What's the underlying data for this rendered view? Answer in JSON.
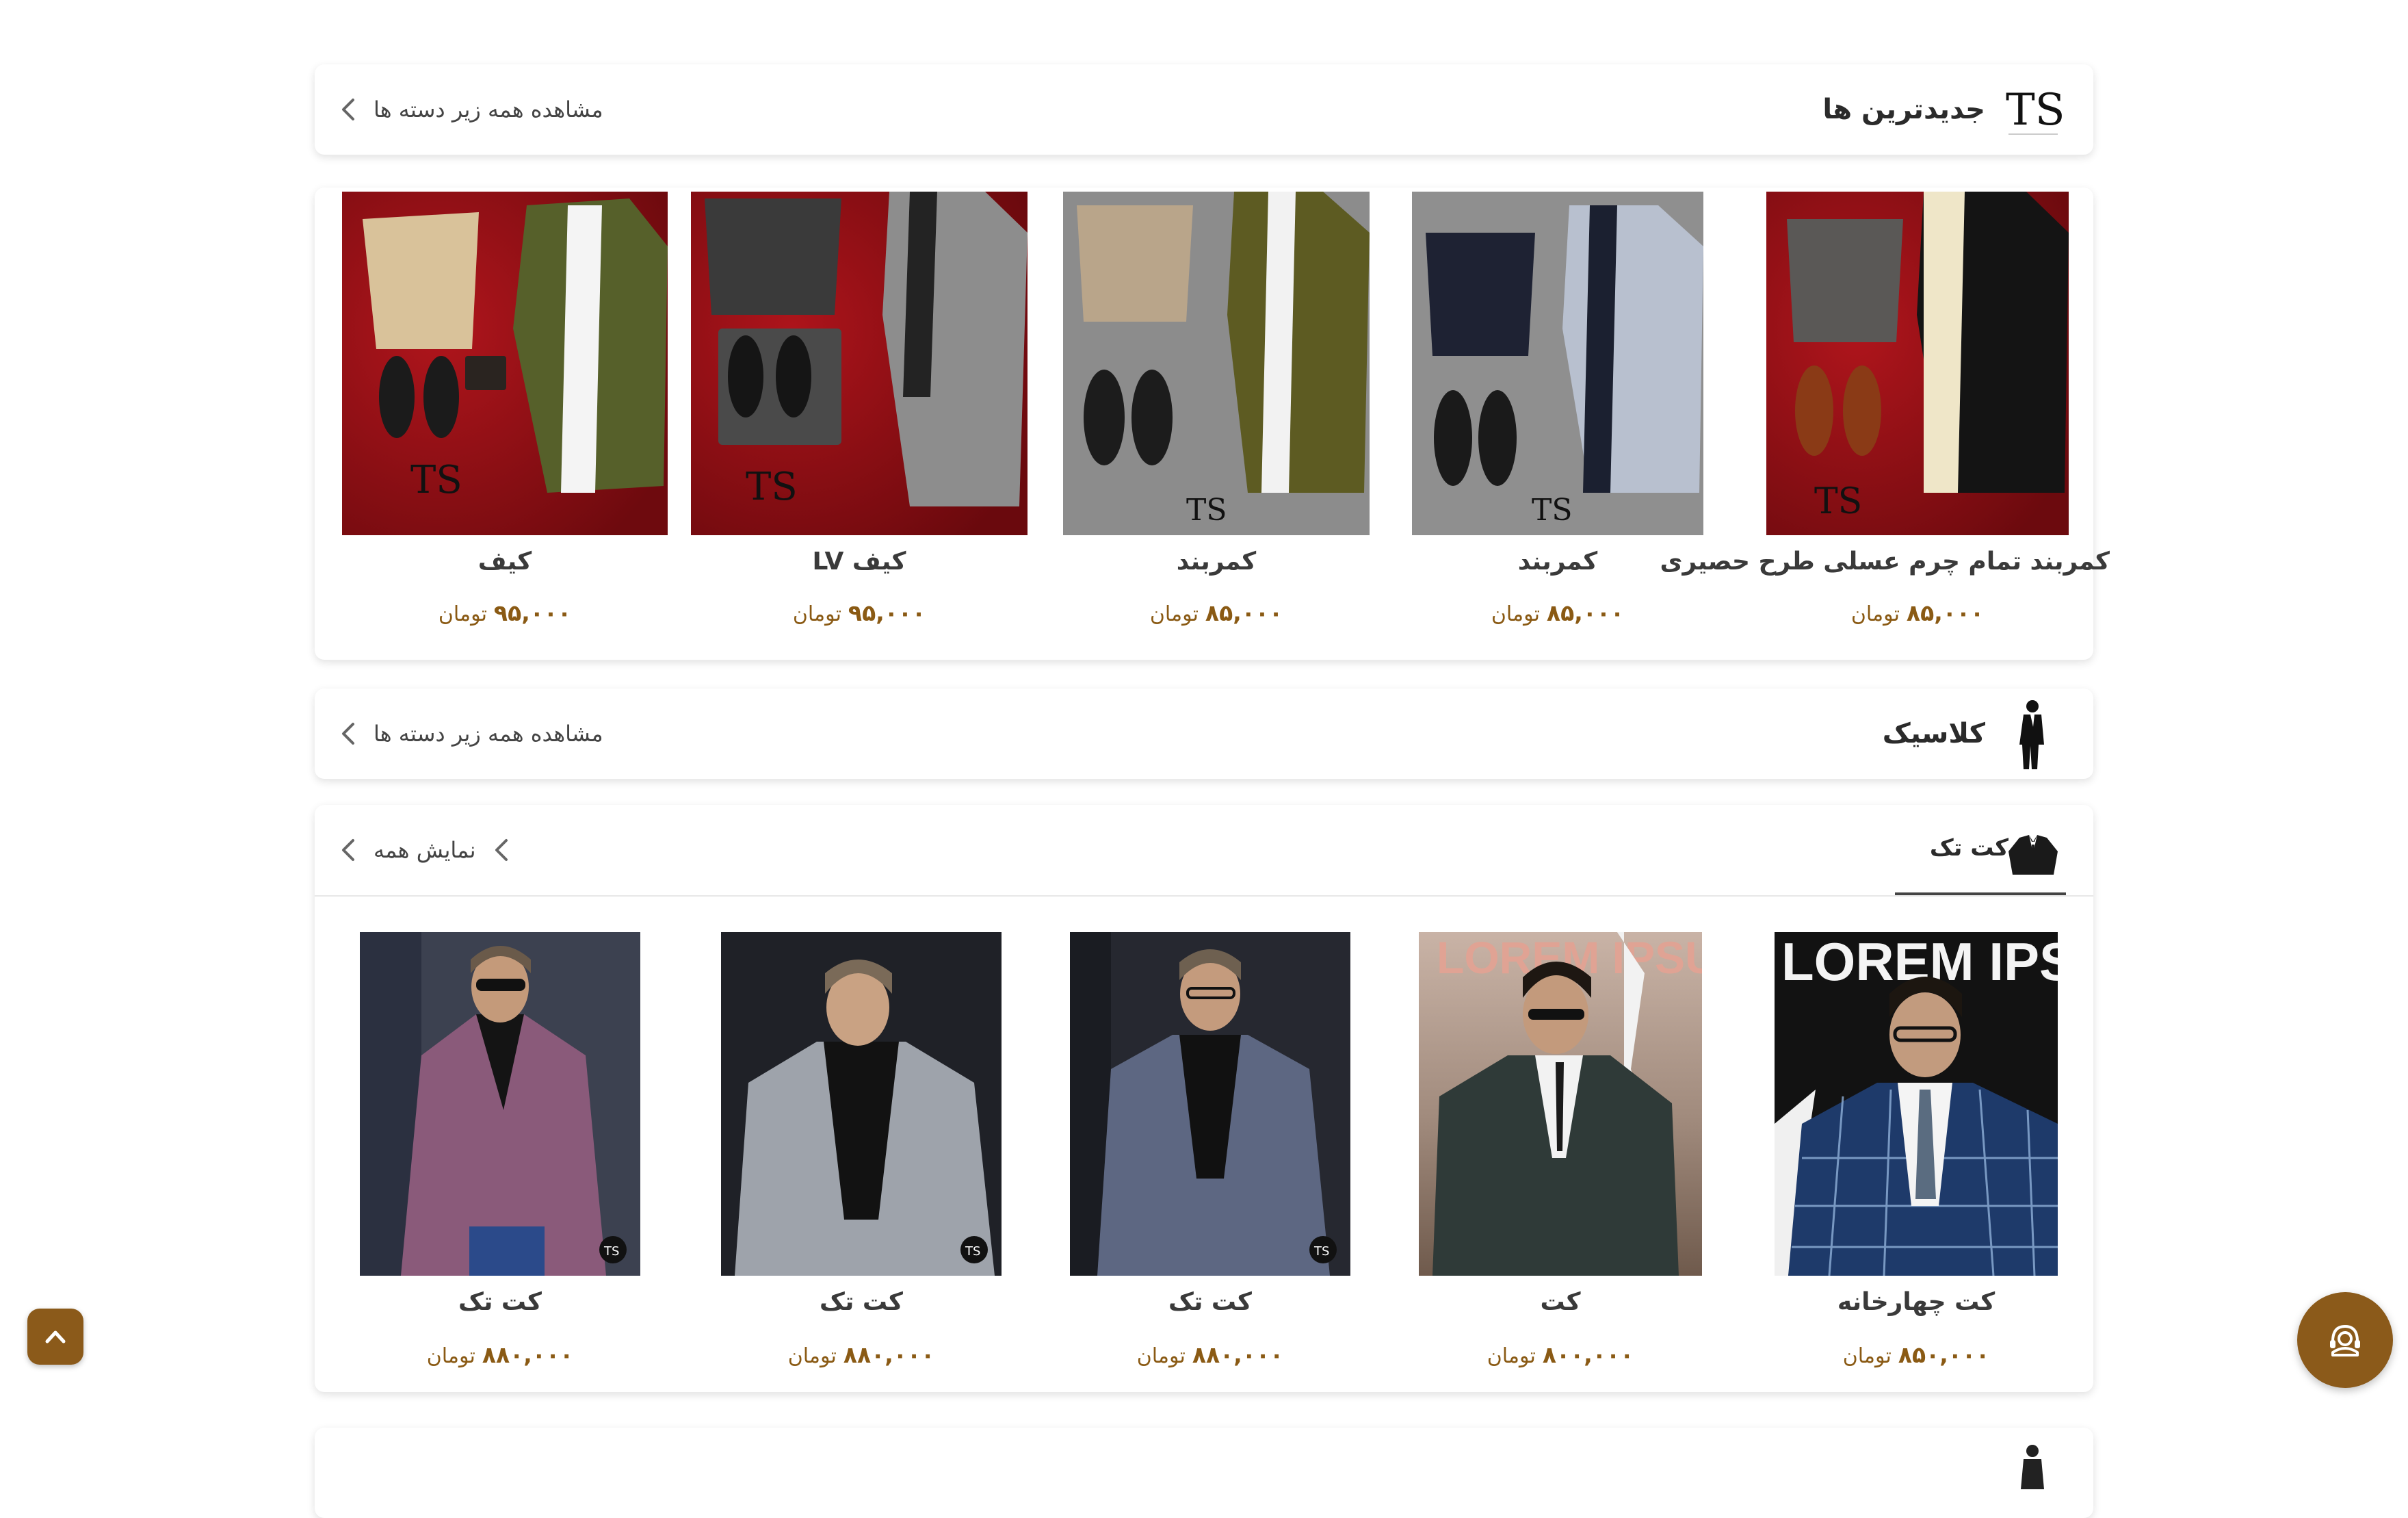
{
  "section_newest": {
    "title": "جدیدترین ها",
    "view_all_label": "مشاهده همه زیر دسته ها",
    "products": [
      {
        "name": "کیف",
        "price": "۹۵,۰۰۰",
        "currency": "تومان"
      },
      {
        "name": "کیف LV",
        "price": "۹۵,۰۰۰",
        "currency": "تومان"
      },
      {
        "name": "کمربند",
        "price": "۸۵,۰۰۰",
        "currency": "تومان"
      },
      {
        "name": "کمربند",
        "price": "۸۵,۰۰۰",
        "currency": "تومان"
      },
      {
        "name": "کمربند تمام چرم عسلی طرح حصیری",
        "price": "۸۵,۰۰۰",
        "currency": "تومان"
      }
    ]
  },
  "section_classic": {
    "title": "کلاسیک",
    "view_all_label": "مشاهده همه زیر دسته ها"
  },
  "section_jackets": {
    "tab_label": "کت تک",
    "show_all_label": "نمایش همه",
    "products": [
      {
        "name": "کت تک",
        "price": "۸۸۰,۰۰۰",
        "currency": "تومان"
      },
      {
        "name": "کت تک",
        "price": "۸۸۰,۰۰۰",
        "currency": "تومان"
      },
      {
        "name": "کت تک",
        "price": "۸۸۰,۰۰۰",
        "currency": "تومان"
      },
      {
        "name": "کت",
        "price": "۸۰۰,۰۰۰",
        "currency": "تومان"
      },
      {
        "name": "کت چهارخانه",
        "price": "۸۵۰,۰۰۰",
        "currency": "تومان"
      }
    ]
  },
  "icons": {
    "support": "headset-icon",
    "back_to_top": "chevron-up-icon",
    "chevron": "chevron-left-icon"
  },
  "colors": {
    "accent": "#8b5a1a",
    "price": "#8a5a14"
  }
}
